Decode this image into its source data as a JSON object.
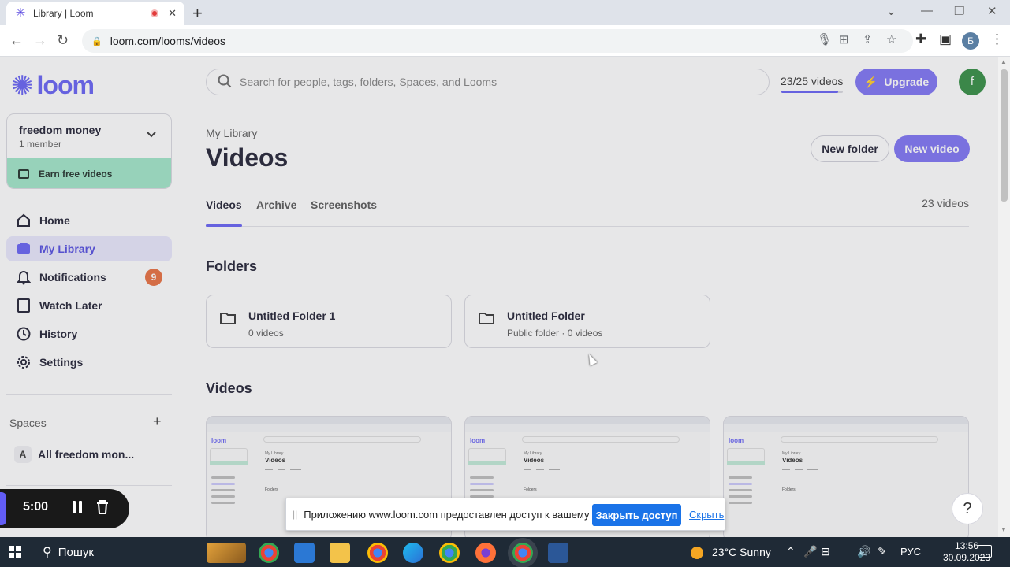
{
  "browser": {
    "tab_title": "Library | Loom",
    "url": "loom.com/looms/videos",
    "profile_initial": "Б"
  },
  "sidebar": {
    "logo_text": "loom",
    "workspace": {
      "name": "freedom money",
      "members": "1 member",
      "earn_label": "Earn free videos"
    },
    "nav": [
      {
        "label": "Home",
        "icon": "home-icon"
      },
      {
        "label": "My Library",
        "icon": "library-icon",
        "active": true
      },
      {
        "label": "Notifications",
        "icon": "bell-icon",
        "badge": "9"
      },
      {
        "label": "Watch Later",
        "icon": "watch-later-icon"
      },
      {
        "label": "History",
        "icon": "clock-icon"
      },
      {
        "label": "Settings",
        "icon": "gear-icon"
      }
    ],
    "spaces_label": "Spaces",
    "space_item": {
      "avatar": "A",
      "label": "All freedom mon..."
    }
  },
  "recorder": {
    "time": "5:00"
  },
  "header": {
    "search_placeholder": "Search for people, tags, folders, Spaces, and Looms",
    "quota_text": "23/25 videos",
    "quota_fraction": 0.92,
    "upgrade_label": "Upgrade",
    "user_initial": "f"
  },
  "main": {
    "breadcrumb": "My Library",
    "title": "Videos",
    "new_folder_label": "New folder",
    "new_video_label": "New video",
    "tabs": [
      "Videos",
      "Archive",
      "Screenshots"
    ],
    "video_count": "23 videos",
    "folders_heading": "Folders",
    "folders": [
      {
        "name": "Untitled Folder 1",
        "meta": "0 videos"
      },
      {
        "name": "Untitled Folder",
        "meta": "Public folder · 0 videos"
      }
    ],
    "videos_heading": "Videos",
    "thumb": {
      "logo": "loom",
      "title": "Videos",
      "sub": "My Library",
      "folders": "Folders"
    }
  },
  "share_notice": {
    "text": "Приложению www.loom.com предоставлен доступ к вашему экрану.",
    "stop_label": "Закрыть доступ",
    "hide_label": "Скрыть"
  },
  "taskbar": {
    "search_label": "Пошук",
    "weather": "23°C  Sunny",
    "language": "РУС",
    "time": "13:56",
    "date": "30.09.2023"
  },
  "colors": {
    "brand": "#625df5",
    "earn_bg": "#9ee6c7",
    "badge": "#e86b3a",
    "share_button": "#1a73e8"
  }
}
